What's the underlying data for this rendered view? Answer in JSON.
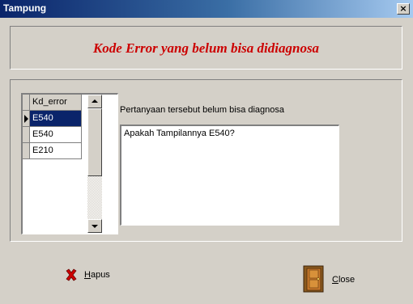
{
  "window": {
    "title": "Tampung",
    "close_glyph": "×"
  },
  "header": {
    "title": "Kode Error yang belum bisa didiagnosa",
    "title_color": "#cc0000"
  },
  "grid": {
    "column_header": "Kd_error",
    "rows": [
      {
        "value": "E540",
        "selected": true
      },
      {
        "value": "E540",
        "selected": false
      },
      {
        "value": "E210",
        "selected": false
      }
    ]
  },
  "question": {
    "label": "Pertanyaan tersebut belum bisa  diagnosa",
    "memo_text": "Apakah Tampilannya E540?"
  },
  "buttons": {
    "hapus": {
      "accel": "H",
      "rest": "apus",
      "icon": "delete-x-icon"
    },
    "close": {
      "accel": "C",
      "rest": "lose",
      "icon": "door-icon"
    }
  },
  "colors": {
    "titlebar_start": "#0a246a",
    "titlebar_end": "#a6caf0",
    "selection": "#0a246a",
    "face": "#d4d0c8"
  }
}
